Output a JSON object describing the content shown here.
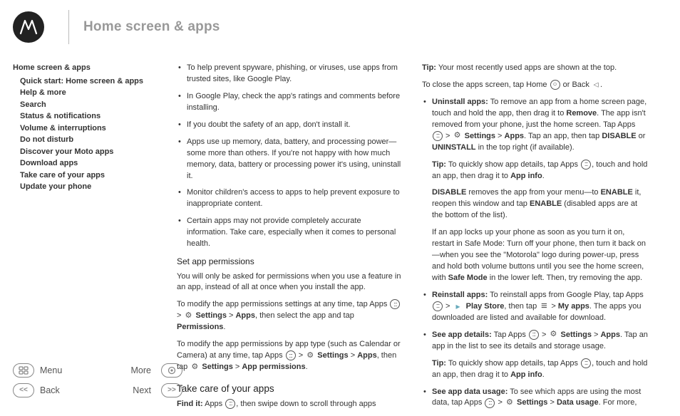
{
  "header": {
    "title": "Home screen & apps"
  },
  "toc": {
    "root": "Home screen & apps",
    "items": [
      "Quick start: Home screen & apps",
      "Help & more",
      "Search",
      "Status & notifications",
      "Volume & interruptions",
      "Do not disturb",
      "Discover your Moto apps",
      "Download apps",
      "Take care of your apps",
      "Update your phone"
    ]
  },
  "nav": {
    "menu": "Menu",
    "back": "Back",
    "more": "More",
    "next": "Next"
  },
  "col1": {
    "b1": "To help prevent spyware, phishing, or viruses, use apps from trusted sites, like Google Play.",
    "b2": "In Google Play, check the app's ratings and comments before installing.",
    "b3": "If you doubt the safety of an app, don't install it.",
    "b4": "Apps use up memory, data, battery, and processing power—some more than others. If you're not happy with how much memory, data, battery or processing power it's using, uninstall it.",
    "b5": "Monitor children's access to apps to help prevent exposure to inappropriate content.",
    "b6": "Certain apps may not provide completely accurate information. Take care, especially when it comes to personal health.",
    "setperm_h": "Set app permissions",
    "setperm_p1": "You will only be asked for permissions when you use a feature in an app, instead of all at once when you install the app.",
    "setperm_p2a": "To modify the app permissions settings at any time, tap Apps ",
    "setperm_p2b": " > ",
    "setperm_p2c": " Settings",
    "setperm_p2d": " > ",
    "setperm_p2e": "Apps",
    "setperm_p2f": ", then select the app and tap ",
    "setperm_p2g": "Permissions",
    "setperm_p2h": ".",
    "setperm_p3a": "To modify the app permissions by app type (such as Calendar or Camera) at any time, tap Apps ",
    "setperm_p3b": " > ",
    "setperm_p3c": " Settings",
    "setperm_p3d": " > ",
    "setperm_p3e": "Apps",
    "setperm_p3f": ", then tap ",
    "setperm_p3g": " Settings",
    "setperm_p3h": " > ",
    "setperm_p3i": "App permissions",
    "setperm_p3j": ".",
    "takecare_h": "Take care of your apps",
    "findit_lbl": "Find it:",
    "findit_a": " Apps ",
    "findit_b": ", then swipe down to scroll through apps"
  },
  "col2": {
    "tip_lbl": "Tip:",
    "tip1": " Your most recently used apps are shown at the top.",
    "close_a": "To close the apps screen, tap Home ",
    "close_b": " or Back ",
    "close_c": ".",
    "uninst_lbl": "Uninstall apps:",
    "uninst_a": " To remove an app from a home screen page, touch and hold the app, then drag it to ",
    "uninst_rem": "Remove",
    "uninst_b": ". The app isn't removed from your phone, just the home screen. Tap Apps ",
    "uninst_c": " > ",
    "uninst_set": " Settings",
    "uninst_d": " > ",
    "uninst_apps": "Apps",
    "uninst_e": ". Tap an app, then tap ",
    "uninst_dis": "DISABLE",
    "uninst_or": " or ",
    "uninst_un": "UNINSTALL",
    "uninst_f": " in the top right (if available).",
    "tip2a": " To quickly show app details, tap Apps ",
    "tip2b": ", touch and hold an app, then drag it to ",
    "tip2c": "App info",
    "tip2d": ".",
    "disable_lbl": "DISABLE",
    "disable_a": " removes the app from your menu—to ",
    "enable_lbl": "ENABLE",
    "disable_b": " it, reopen this window and tap ",
    "disable_c": " (disabled apps are at the bottom of the list).",
    "safemode_a": "If an app locks up your phone as soon as you turn it on, restart in Safe Mode: Turn off your phone, then turn it back on—when you see the \"Motorola\" logo during power-up, press and hold both volume buttons until you see the home screen, with ",
    "safemode_lbl": "Safe Mode",
    "safemode_b": " in the lower left. Then, try removing the app.",
    "reinst_lbl": "Reinstall apps:",
    "reinst_a": " To reinstall apps from Google Play, tap Apps ",
    "reinst_b": " > ",
    "reinst_play": " Play Store",
    "reinst_c": ", then tap ",
    "reinst_d": " > ",
    "reinst_my": "My apps",
    "reinst_e": ". The apps you downloaded are listed and available for download.",
    "detail_lbl": "See app details:",
    "detail_a": " Tap Apps ",
    "detail_b": " > ",
    "detail_set": " Settings",
    "detail_c": " > ",
    "detail_apps": "Apps",
    "detail_d": ". Tap an app in the list to see its details and storage usage.",
    "tip3a": " To quickly show app details, tap Apps ",
    "tip3b": ", touch and hold an app, then drag it to ",
    "tip3c": "App info",
    "tip3d": ".",
    "usage_lbl": "See app data usage:",
    "usage_a": " To see which apps are using the most data, tap Apps ",
    "usage_b": " > ",
    "usage_set": " Settings",
    "usage_c": " > ",
    "usage_du": "Data usage",
    "usage_d": ". For more,"
  }
}
